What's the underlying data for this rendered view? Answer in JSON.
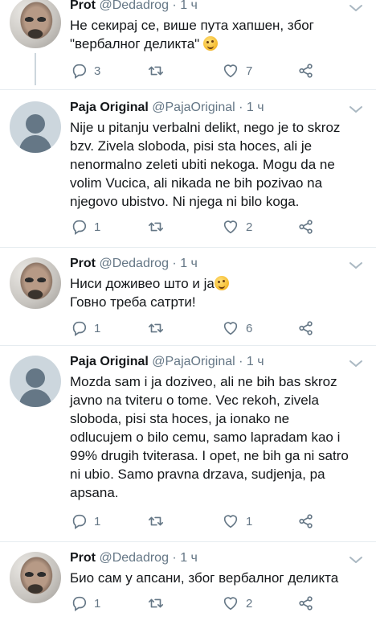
{
  "tweets": [
    {
      "author": "Prot",
      "handle": "@Dedadrog",
      "separator": "·",
      "time": "1 ч",
      "avatar": "photo",
      "lines": [
        "Не секирај се, више пута хапшен, због",
        "\"вербалног деликта\""
      ],
      "emoji_after": "winking-face",
      "replies": "3",
      "retweets": "",
      "likes": "7"
    },
    {
      "author": "Paja Original",
      "handle": "@PajaOriginal",
      "separator": "·",
      "time": "1 ч",
      "avatar": "default",
      "lines": [
        "Nije u pitanju verbalni delikt, nego je to skroz",
        "bzv. Zivela sloboda, pisi sta hoces, ali je",
        "nenormalno zeleti ubiti nekoga. Mogu da ne",
        "volim Vucica, ali nikada ne bih pozivao na",
        "njegovo ubistvo. Ni njega ni bilo koga."
      ],
      "replies": "1",
      "retweets": "",
      "likes": "2"
    },
    {
      "author": "Prot",
      "handle": "@Dedadrog",
      "separator": "·",
      "time": "1 ч",
      "avatar": "photo",
      "lines": [
        "Ниси доживео што и ја",
        "Говно треба сатрти!"
      ],
      "emoji_after_line_1": "winking-face",
      "replies": "1",
      "retweets": "",
      "likes": "6"
    },
    {
      "author": "Paja Original",
      "handle": "@PajaOriginal",
      "separator": "·",
      "time": "1 ч",
      "avatar": "default",
      "lines": [
        "Mozda sam i ja doziveo, ali ne bih bas skroz",
        "javno na tviteru o tome. Vec rekoh, zivela",
        "sloboda, pisi sta hoces, ja ionako ne",
        "odlucujem o bilo cemu, samo lapradam kao i",
        "99% drugih tviterasa. I opet, ne bih ga ni satro",
        "ni ubio. Samo pravna drzava, sudjenja, pa",
        "apsana."
      ],
      "replies": "1",
      "retweets": "",
      "likes": "1"
    },
    {
      "author": "Prot",
      "handle": "@Dedadrog",
      "separator": "·",
      "time": "1 ч",
      "avatar": "photo",
      "lines": [
        "Био сам у апсани, због вербалног деликта"
      ],
      "replies": "1",
      "retweets": "",
      "likes": "2"
    }
  ],
  "icons": {
    "reply": "reply-icon",
    "retweet": "retweet-icon",
    "like": "heart-icon",
    "share": "share-icon",
    "more": "chevron-down-icon",
    "emoji": "winking-face-icon"
  },
  "colors": {
    "text": "#14171a",
    "secondary": "#657786",
    "thread_line": "#ccd6dd",
    "separator": "#e6ecf0"
  }
}
